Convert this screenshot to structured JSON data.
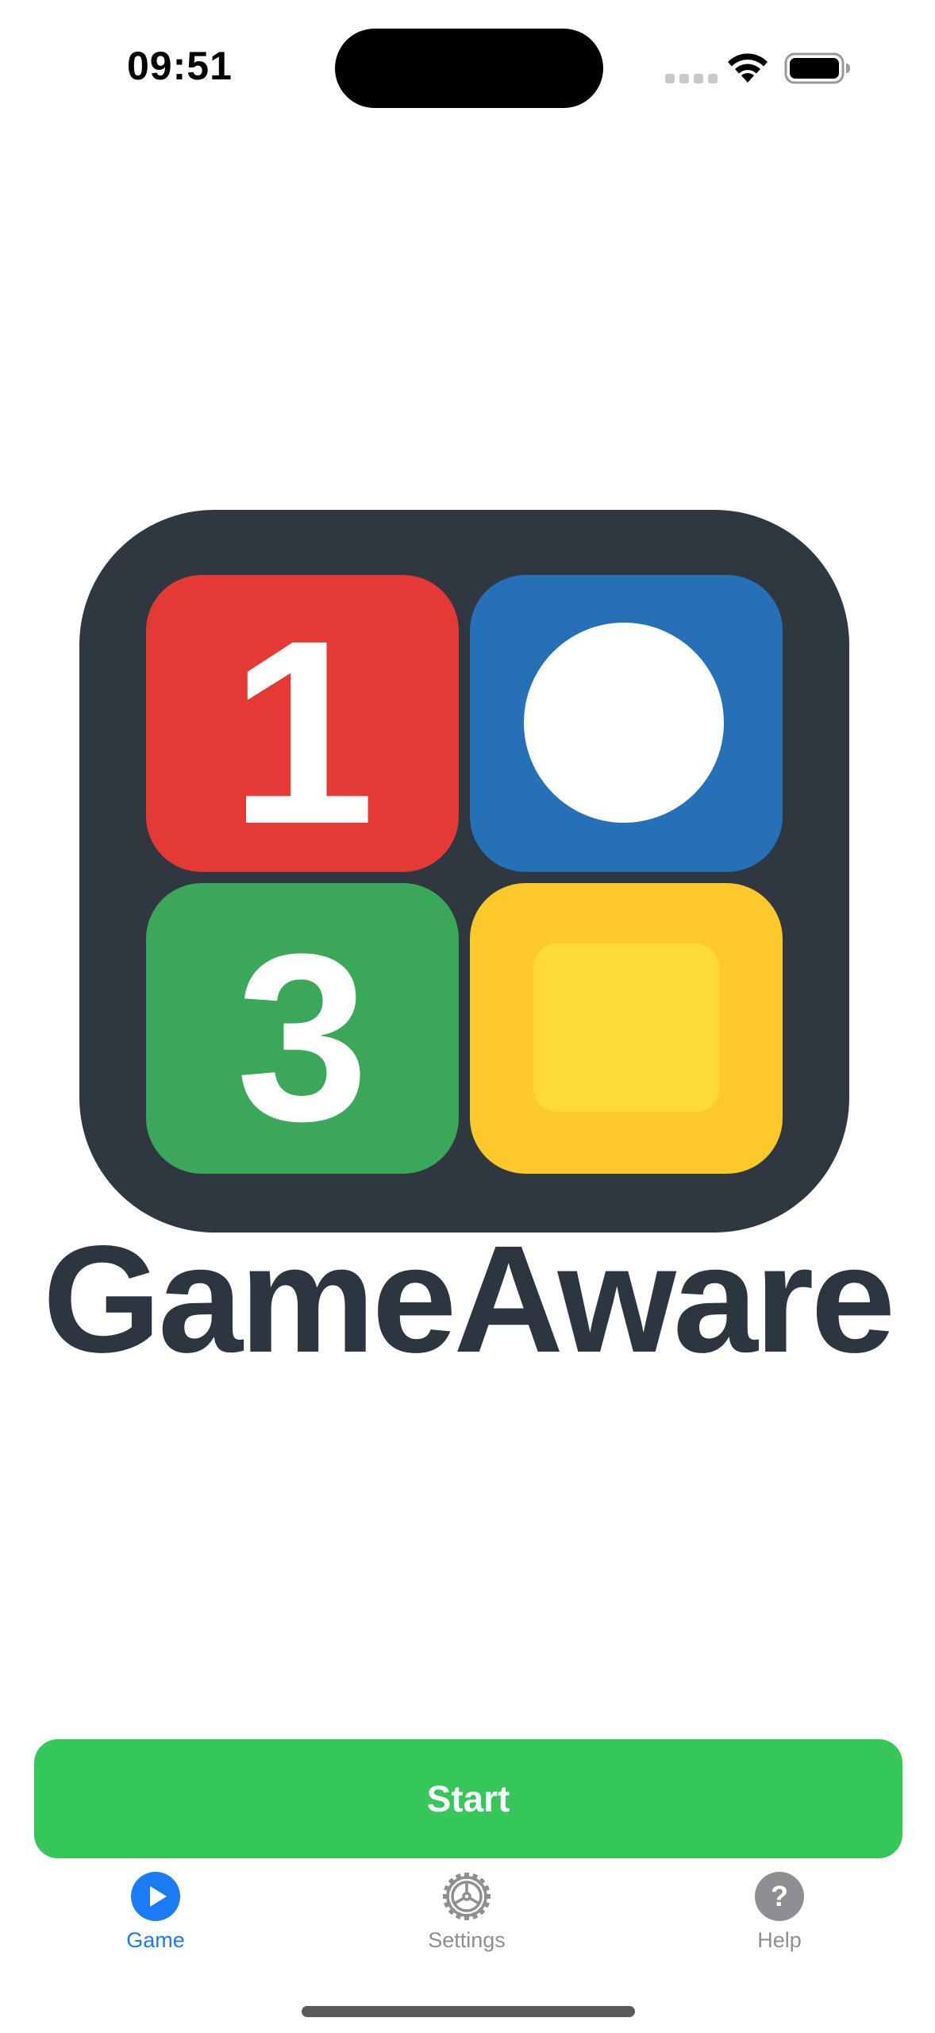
{
  "status_bar": {
    "time": "09:51"
  },
  "logo": {
    "app_name": "GameAware",
    "tile_labels": [
      "1",
      "3"
    ],
    "colors": {
      "frame": "#2f3741",
      "red": "#e53936",
      "blue": "#2670b8",
      "green": "#3ba75a",
      "yellow": "#fcc82a",
      "yellow_inner": "#fdda38"
    }
  },
  "start_button": {
    "label": "Start",
    "color": "#35c759"
  },
  "tab_bar": {
    "tabs": [
      {
        "label": "Game",
        "icon": "play-circle-icon",
        "active": true,
        "color": "#1a7cf5"
      },
      {
        "label": "Settings",
        "icon": "gear-icon",
        "active": false,
        "color": "#8e8e93"
      },
      {
        "label": "Help",
        "icon": "question-circle-icon",
        "active": false,
        "color": "#8e8e93"
      }
    ]
  }
}
